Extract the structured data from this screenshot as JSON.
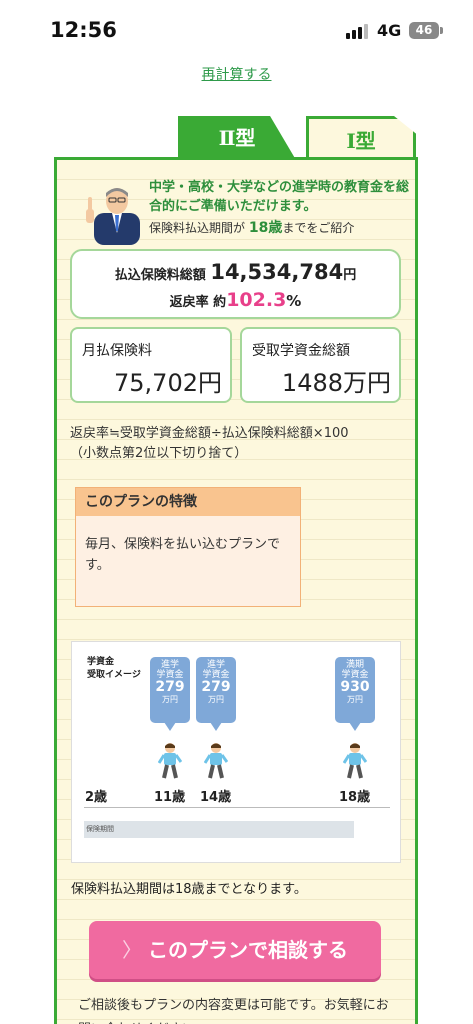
{
  "status": {
    "time": "12:56",
    "network": "4G",
    "battery": "46"
  },
  "recalc_link": "再計算する",
  "tabs": {
    "type2": "Ⅱ型",
    "type1": "Ⅰ型"
  },
  "intro": {
    "headline": "中学・高校・大学などの進学時の教育金を総合的にご準備いただけます。",
    "period_prefix": "保険料払込期間が",
    "period_age": "18歳",
    "period_suffix": "までをご紹介"
  },
  "totals": {
    "premium_label": "払込保険料総額",
    "premium_value": "14,534,784",
    "premium_unit": "円",
    "return_label": "返戻率 約",
    "return_value": "102.3",
    "return_unit": "%"
  },
  "monthly": {
    "label": "月払保険料",
    "value": "75,702円"
  },
  "benefit": {
    "label": "受取学資金総額",
    "value": "1488万円"
  },
  "formula": {
    "line1": "返戻率≒受取学資金総額÷払込保険料総額×100",
    "line2": "（小数点第2位以下切り捨て）"
  },
  "feature": {
    "title": "このプランの特徴",
    "body": "毎月、保険料を払い込むプランです。"
  },
  "diagram": {
    "title_line1": "学資金",
    "title_line2": "受取イメージ",
    "bubbles": [
      {
        "l1": "進学",
        "l2": "学資金",
        "amount": "279",
        "unit": "万円"
      },
      {
        "l1": "進学",
        "l2": "学資金",
        "amount": "279",
        "unit": "万円"
      },
      {
        "l1": "満期",
        "l2": "学資金",
        "amount": "930",
        "unit": "万円"
      }
    ],
    "ages": [
      "2歳",
      "11歳",
      "14歳",
      "18歳"
    ],
    "period_label": "保険期間"
  },
  "period_note": "保険料払込期間は18歳までとなります。",
  "consult_button": {
    "chevron": "〉",
    "label": "このプランで相談する"
  },
  "footnote": "ご相談後もプランの内容変更は可能です。お気軽にお問い合わせください。",
  "colors": {
    "green": "#3aaa35",
    "pink": "#e8408a",
    "button": "#f06aa0",
    "panel": "#fdf8dd"
  }
}
